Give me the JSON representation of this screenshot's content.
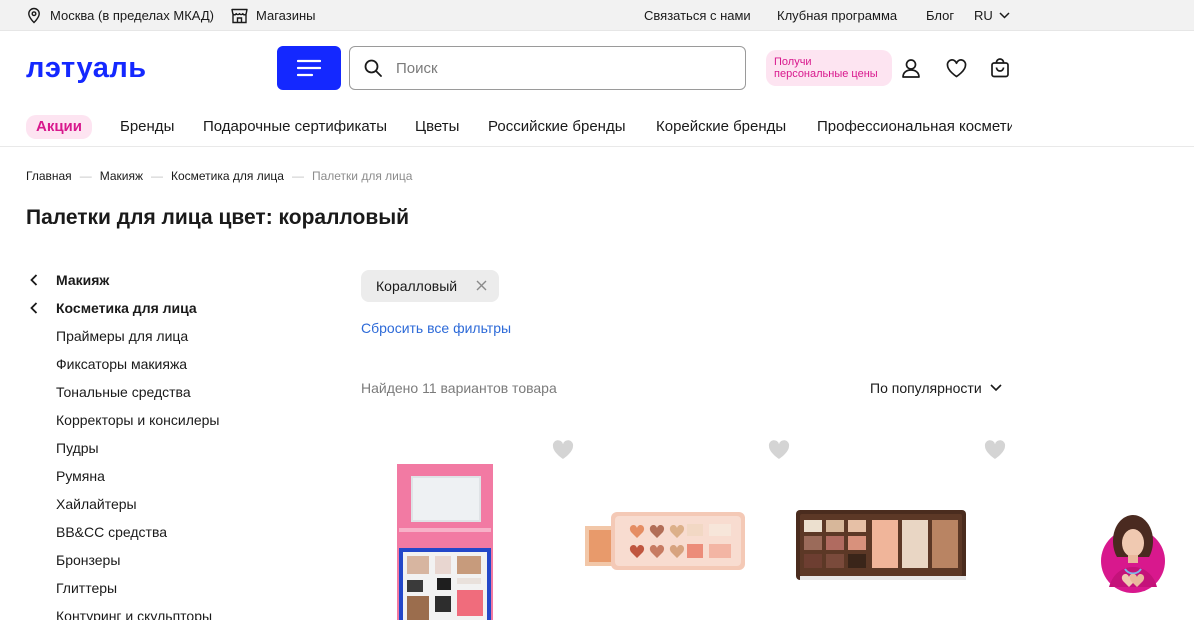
{
  "topbar": {
    "location": "Москва (в пределах МКАД)",
    "stores": "Магазины",
    "contact": "Связаться с нами",
    "club": "Клубная программа",
    "blog": "Блог",
    "lang": "RU"
  },
  "header": {
    "logo_text": "лэтуаль",
    "search_placeholder": "Поиск",
    "promo_line1": "Получи",
    "promo_line2": "персональные цены"
  },
  "nav": {
    "items": [
      "Акции",
      "Бренды",
      "Подарочные сертификаты",
      "Цветы",
      "Российские бренды",
      "Корейские бренды",
      "Профессиональная косметика"
    ]
  },
  "breadcrumbs": [
    "Главная",
    "Макияж",
    "Косметика для лица",
    "Палетки для лица"
  ],
  "page_title": "Палетки для лица цвет: коралловый",
  "sidebar": {
    "parents": [
      "Макияж",
      "Косметика для лица"
    ],
    "items": [
      "Праймеры для лица",
      "Фиксаторы макияжа",
      "Тональные средства",
      "Корректоры и консилеры",
      "Пудры",
      "Румяна",
      "Хайлайтеры",
      "BB&CC средства",
      "Бронзеры",
      "Глиттеры",
      "Контуринг и скульпторы"
    ]
  },
  "filters": {
    "chip_label": "Коралловый",
    "reset_label": "Сбросить все фильтры"
  },
  "results": {
    "found_text": "Найдено 11 вариантов товара",
    "sort_label": "По популярности"
  },
  "colors": {
    "brand_blue": "#1428ff",
    "promo_pink": "#d8188d",
    "promo_bg": "#fde4f1",
    "link_blue": "#2d6ad8"
  },
  "icons": [
    "location-pin-icon",
    "store-icon",
    "chevron-down-icon",
    "menu-icon",
    "search-icon",
    "user-icon",
    "heart-icon",
    "cart-icon",
    "chevron-left-icon",
    "close-icon"
  ]
}
